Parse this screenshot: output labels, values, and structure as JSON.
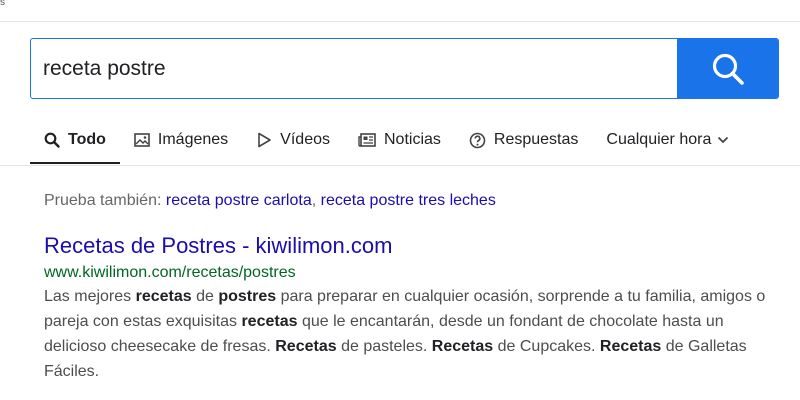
{
  "search": {
    "query": "receta postre",
    "button_icon": "search-icon"
  },
  "tabs": [
    {
      "label": "Todo",
      "icon": "search-icon",
      "active": true
    },
    {
      "label": "Imágenes",
      "icon": "image-icon"
    },
    {
      "label": "Vídeos",
      "icon": "play-icon"
    },
    {
      "label": "Noticias",
      "icon": "news-icon"
    },
    {
      "label": "Respuestas",
      "icon": "question-icon"
    },
    {
      "label": "Cualquier hora",
      "icon": "chevron-down-icon"
    }
  ],
  "try_also": {
    "prefix": "Prueba también:",
    "links": [
      "receta postre carlota",
      "receta postre tres leches"
    ],
    "separator": ","
  },
  "result": {
    "title": "Recetas de Postres - kiwilimon.com",
    "url": "www.kiwilimon.com/recetas/postres",
    "snippet": [
      {
        "text": "Las mejores "
      },
      {
        "text": "recetas",
        "bold": true
      },
      {
        "text": " de "
      },
      {
        "text": "postres",
        "bold": true
      },
      {
        "text": " para preparar en cualquier ocasión, sorprende a tu familia, amigos o pareja con estas exquisitas "
      },
      {
        "text": "recetas",
        "bold": true
      },
      {
        "text": " que le encantarán, desde un fondant de chocolate hasta un delicioso cheesecake de fresas. "
      },
      {
        "text": "Recetas",
        "bold": true
      },
      {
        "text": " de pasteles. "
      },
      {
        "text": "Recetas",
        "bold": true
      },
      {
        "text": " de Cupcakes. "
      },
      {
        "text": "Recetas",
        "bold": true
      },
      {
        "text": " de Galletas Fáciles."
      }
    ]
  },
  "colors": {
    "accent": "#1a73e8",
    "link": "#1a0dab",
    "url_green": "#006621"
  }
}
